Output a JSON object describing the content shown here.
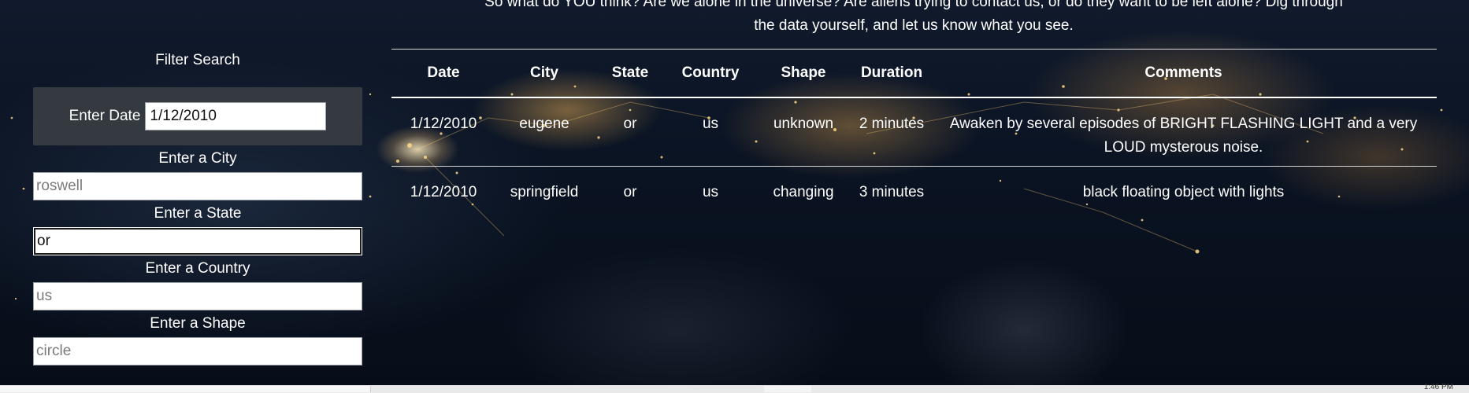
{
  "intro": {
    "line1": "So what do YOU think? Are we alone in the universe? Are aliens trying to contact us, or do they want to be left alone? Dig through",
    "line2": "the data yourself, and let us know what you see."
  },
  "filter": {
    "title": "Filter Search",
    "date_label": "Enter Date",
    "date_value": "1/12/2010",
    "city_label": "Enter a City",
    "city_placeholder": "roswell",
    "state_label": "Enter a State",
    "state_value": "or",
    "country_label": "Enter a Country",
    "country_placeholder": "us",
    "shape_label": "Enter a Shape",
    "shape_placeholder": "circle"
  },
  "table": {
    "headers": {
      "date": "Date",
      "city": "City",
      "state": "State",
      "country": "Country",
      "shape": "Shape",
      "duration": "Duration",
      "comments": "Comments"
    },
    "rows": [
      {
        "date": "1/12/2010",
        "city": "eugene",
        "state": "or",
        "country": "us",
        "shape": "unknown",
        "duration": "2 minutes",
        "comments": "Awaken by several episodes of BRIGHT FLASHING LIGHT and a very LOUD mysterous noise."
      },
      {
        "date": "1/12/2010",
        "city": "springfield",
        "state": "or",
        "country": "us",
        "shape": "changing",
        "duration": "3 minutes",
        "comments": "black floating object with lights"
      }
    ]
  },
  "taskbar": {
    "clock": "1:46 PM"
  },
  "colors": {
    "panel": "#343a40",
    "text": "#ffffff",
    "rule": "#d8d8d8"
  }
}
